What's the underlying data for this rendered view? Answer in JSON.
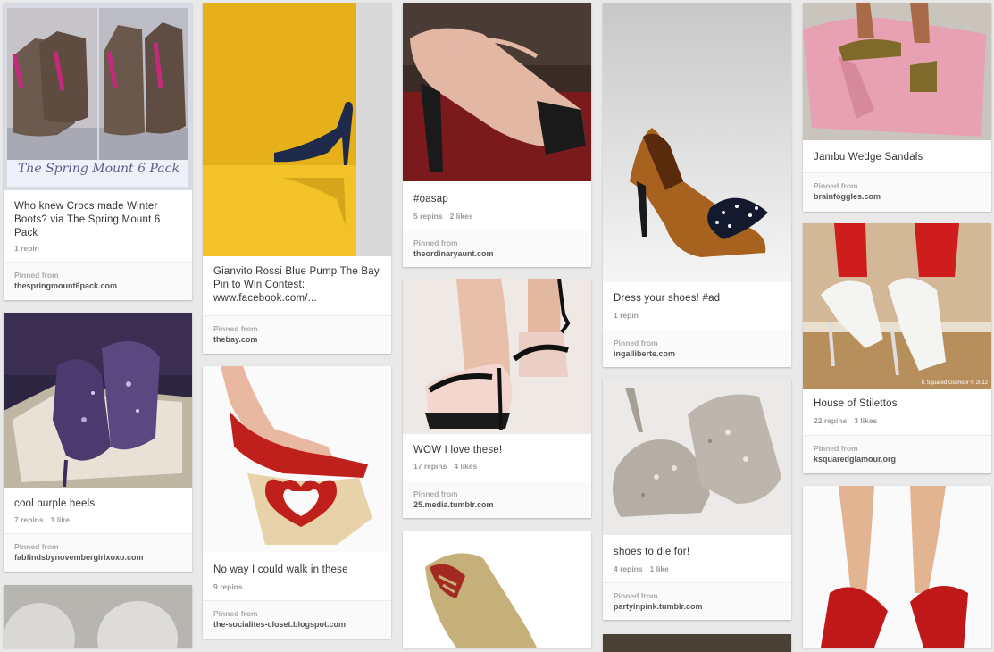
{
  "pins": [
    {
      "id": "p1",
      "description": "Who knew Crocs made Winter Boots? via The Spring Mount 6 Pack",
      "overlay_text": "The Spring Mount 6 Pack",
      "repins": "1 repin",
      "likes": "",
      "pinned_from_label": "Pinned from",
      "source": "thespringmount6pack.com"
    },
    {
      "id": "p2",
      "description": "cool purple heels",
      "repins": "7 repins",
      "likes": "1 like",
      "pinned_from_label": "Pinned from",
      "source": "fabfindsbynovembergirlxoxo.com"
    },
    {
      "id": "p3",
      "description": "Gianvito Rossi Blue Pump The Bay Pin to Win Contest: www.facebook.com/...",
      "repins": "",
      "likes": "",
      "pinned_from_label": "Pinned from",
      "source": "thebay.com"
    },
    {
      "id": "p4",
      "description": "No way I could walk in these",
      "repins": "9 repins",
      "likes": "",
      "pinned_from_label": "Pinned from",
      "source": "the-socialites-closet.blogspot.com"
    },
    {
      "id": "p5",
      "description": "#oasap",
      "repins": "5 repins",
      "likes": "2 likes",
      "pinned_from_label": "Pinned from",
      "source": "theordinaryaunt.com"
    },
    {
      "id": "p6",
      "description": "WOW I love these!",
      "repins": "17 repins",
      "likes": "4 likes",
      "pinned_from_label": "Pinned from",
      "source": "25.media.tumblr.com"
    },
    {
      "id": "p7",
      "description": "Dress your shoes! #ad",
      "repins": "1 repin",
      "likes": "",
      "pinned_from_label": "Pinned from",
      "source": "ingalliberte.com"
    },
    {
      "id": "p8",
      "description": "shoes to die for!",
      "repins": "4 repins",
      "likes": "1 like",
      "pinned_from_label": "Pinned from",
      "source": "partyinpink.tumblr.com"
    },
    {
      "id": "p9",
      "description": "Jambu Wedge Sandals",
      "repins": "",
      "likes": "",
      "pinned_from_label": "Pinned from",
      "source": "brainfoggles.com"
    },
    {
      "id": "p10",
      "description": "House of Stilettos",
      "watermark": "K Squared Glamour © 2012",
      "repins": "22 repins",
      "likes": "3 likes",
      "pinned_from_label": "Pinned from",
      "source": "ksquaredglamour.org"
    }
  ]
}
